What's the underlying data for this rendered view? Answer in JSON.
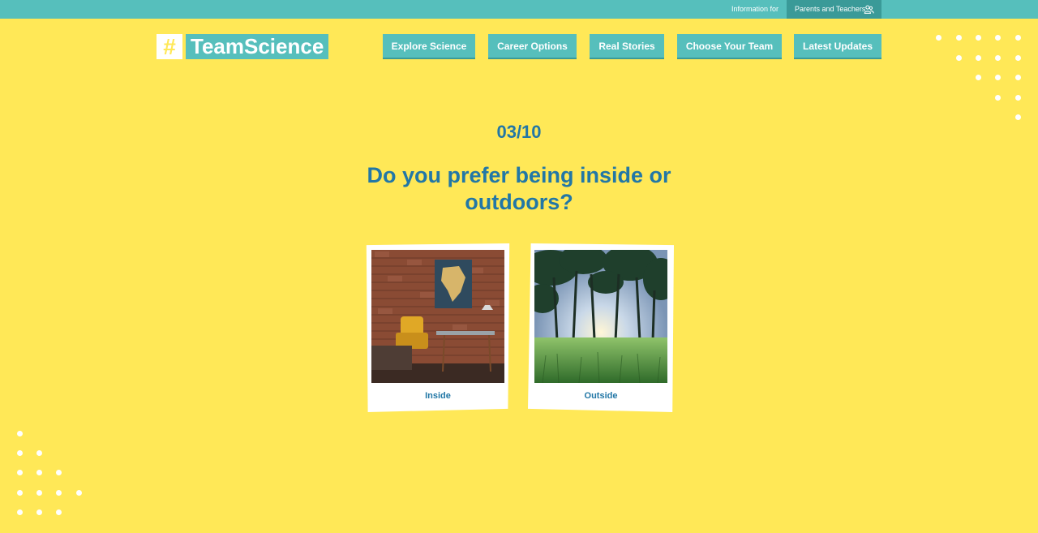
{
  "topbar": {
    "info_label": "Information for",
    "audience_label": "Parents and Teachers",
    "audience_icon": "people-icon"
  },
  "logo": {
    "hash": "#",
    "text": "TeamScience"
  },
  "nav": {
    "items": [
      {
        "label": "Explore Science"
      },
      {
        "label": "Career Options"
      },
      {
        "label": "Real Stories"
      },
      {
        "label": "Choose Your Team"
      },
      {
        "label": "Latest Updates"
      }
    ]
  },
  "quiz": {
    "progress": "03/10",
    "question": "Do you prefer being inside or outdoors?",
    "options": [
      {
        "label": "Inside",
        "image": "room-with-brick-wall-photo"
      },
      {
        "label": "Outside",
        "image": "trees-and-grass-photo"
      }
    ]
  },
  "colors": {
    "background": "#ffe857",
    "accent": "#56bfbc",
    "accent_dark": "#3a9a98",
    "text": "#2277a6"
  }
}
